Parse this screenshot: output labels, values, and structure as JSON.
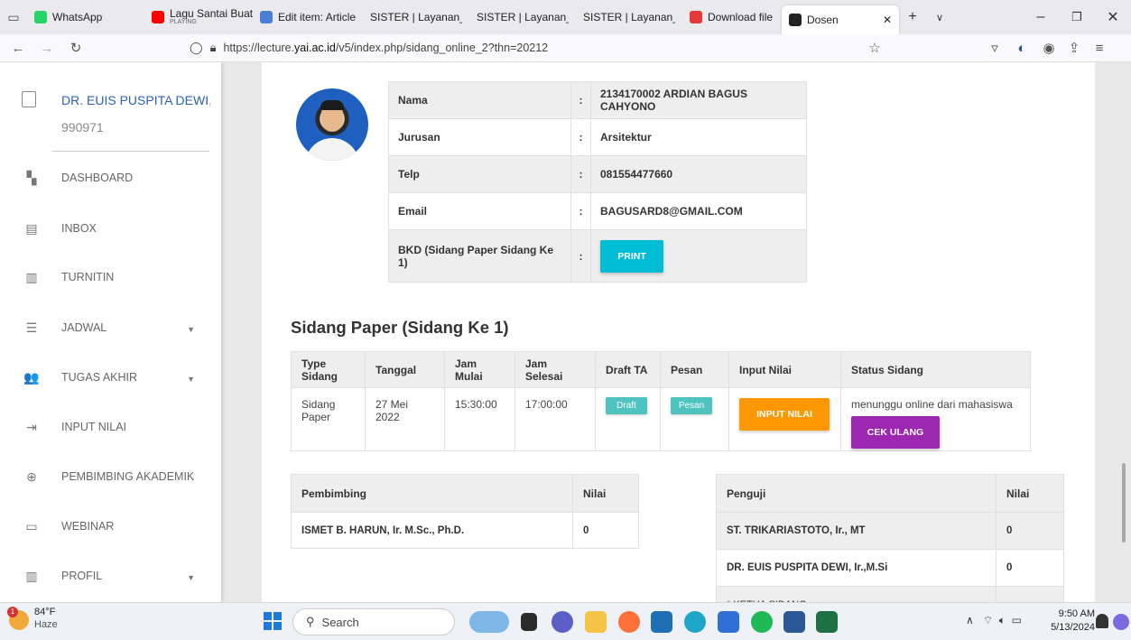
{
  "browser": {
    "tabs": [
      {
        "label": "WhatsApp",
        "sub": "",
        "icon": "whatsapp-icon",
        "color": "#25d366"
      },
      {
        "label": "Lagu Santai Buat",
        "sub": "PLAYING",
        "icon": "youtube-icon",
        "color": "#ff0000"
      },
      {
        "label": "Edit item: Article",
        "sub": "",
        "icon": "document-icon",
        "color": "#4a7fd4"
      },
      {
        "label": "SISTER | Layanan_bkd",
        "sub": "",
        "icon": "",
        "color": ""
      },
      {
        "label": "SISTER | Layanan_bkd",
        "sub": "",
        "icon": "",
        "color": ""
      },
      {
        "label": "SISTER | Layanan_bkd",
        "sub": "",
        "icon": "",
        "color": ""
      },
      {
        "label": "Download file | il",
        "sub": "",
        "icon": "heart-icon",
        "color": "#e53935"
      },
      {
        "label": "Dosen",
        "sub": "",
        "icon": "bowtie-icon",
        "color": "#222"
      }
    ],
    "url_prefix": "https://lecture.",
    "url_domain": "yai.ac.id",
    "url_path": "/v5/index.php/sidang_online_2?thn=20212"
  },
  "sidebar": {
    "user_name": "DR. EUIS PUSPITA DEWI, I",
    "user_id": "990971",
    "items": [
      {
        "label": "DASHBOARD",
        "icon": "dashboard-icon",
        "glyph": "▚",
        "caret": false
      },
      {
        "label": "INBOX",
        "icon": "inbox-icon",
        "glyph": "▤",
        "caret": false
      },
      {
        "label": "TURNITIN",
        "icon": "turnitin-icon",
        "glyph": "▥",
        "caret": false
      },
      {
        "label": "JADWAL",
        "icon": "schedule-icon",
        "glyph": "☰",
        "caret": true
      },
      {
        "label": "TUGAS AKHIR",
        "icon": "people-icon",
        "glyph": "👥",
        "caret": true
      },
      {
        "label": "INPUT NILAI",
        "icon": "input-icon",
        "glyph": "⇥",
        "caret": false
      },
      {
        "label": "PEMBIMBING AKADEMIK",
        "icon": "globe-icon",
        "glyph": "⊕",
        "caret": false
      },
      {
        "label": "WEBINAR",
        "icon": "webinar-icon",
        "glyph": "▭",
        "caret": false
      },
      {
        "label": "PROFIL",
        "icon": "profile-icon",
        "glyph": "▥",
        "caret": true
      }
    ]
  },
  "student": {
    "rows": [
      {
        "label": "Nama",
        "sep": ":",
        "value": "2134170002 ARDIAN BAGUS CAHYONO"
      },
      {
        "label": "Jurusan",
        "sep": ":",
        "value": "Arsitektur"
      },
      {
        "label": "Telp",
        "sep": ":",
        "value": "081554477660"
      },
      {
        "label": "Email",
        "sep": ":",
        "value": "BAGUSARD8@GMAIL.COM"
      }
    ],
    "bkd_label": "BKD (Sidang Paper Sidang Ke 1)",
    "bkd_sep": ":",
    "print_label": "PRINT"
  },
  "sidang": {
    "title": "Sidang Paper (Sidang Ke 1)",
    "headers": [
      "Type Sidang",
      "Tanggal",
      "Jam Mulai",
      "Jam Selesai",
      "Draft TA",
      "Pesan",
      "Input Nilai",
      "Status Sidang"
    ],
    "row": {
      "type": "Sidang Paper",
      "tanggal": "27 Mei 2022",
      "jam_mulai": "15:30:00",
      "jam_selesai": "17:00:00",
      "draft_label": "Draft",
      "pesan_label": "Pesan",
      "input_label": "INPUT NILAI",
      "status_text": "menunggu online dari mahasiswa",
      "cek_label": "CEK ULANG"
    }
  },
  "pembimbing": {
    "headers": [
      "Pembimbing",
      "Nilai"
    ],
    "rows": [
      {
        "name": "ISMET B. HARUN, Ir. M.Sc., Ph.D.",
        "nilai": "0"
      }
    ]
  },
  "penguji": {
    "headers": [
      "Penguji",
      "Nilai"
    ],
    "rows": [
      {
        "name": "ST. TRIKARIASTOTO, Ir., MT",
        "nilai": "0"
      },
      {
        "name": "DR. EUIS PUSPITA DEWI, Ir.,M.Si",
        "nilai": "0"
      },
      {
        "name": "* KETUA SIDANG",
        "nilai": ""
      }
    ]
  },
  "taskbar": {
    "weather_temp": "84°F",
    "weather_cond": "Haze",
    "weather_badge": "1",
    "search_label": "Search",
    "time": "9:50 AM",
    "date": "5/13/2024"
  }
}
